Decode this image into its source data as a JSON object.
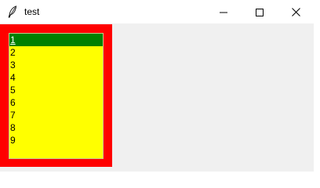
{
  "window": {
    "title": "test",
    "controls": {
      "minimize": "minimize",
      "maximize": "maximize",
      "close": "close"
    }
  },
  "listbox": {
    "frame_color": "#ff0000",
    "background_color": "#ffff00",
    "selected_color": "#008000",
    "selected_index": 0,
    "items": [
      "1",
      "2",
      "3",
      "4",
      "5",
      "6",
      "7",
      "8",
      "9"
    ]
  }
}
